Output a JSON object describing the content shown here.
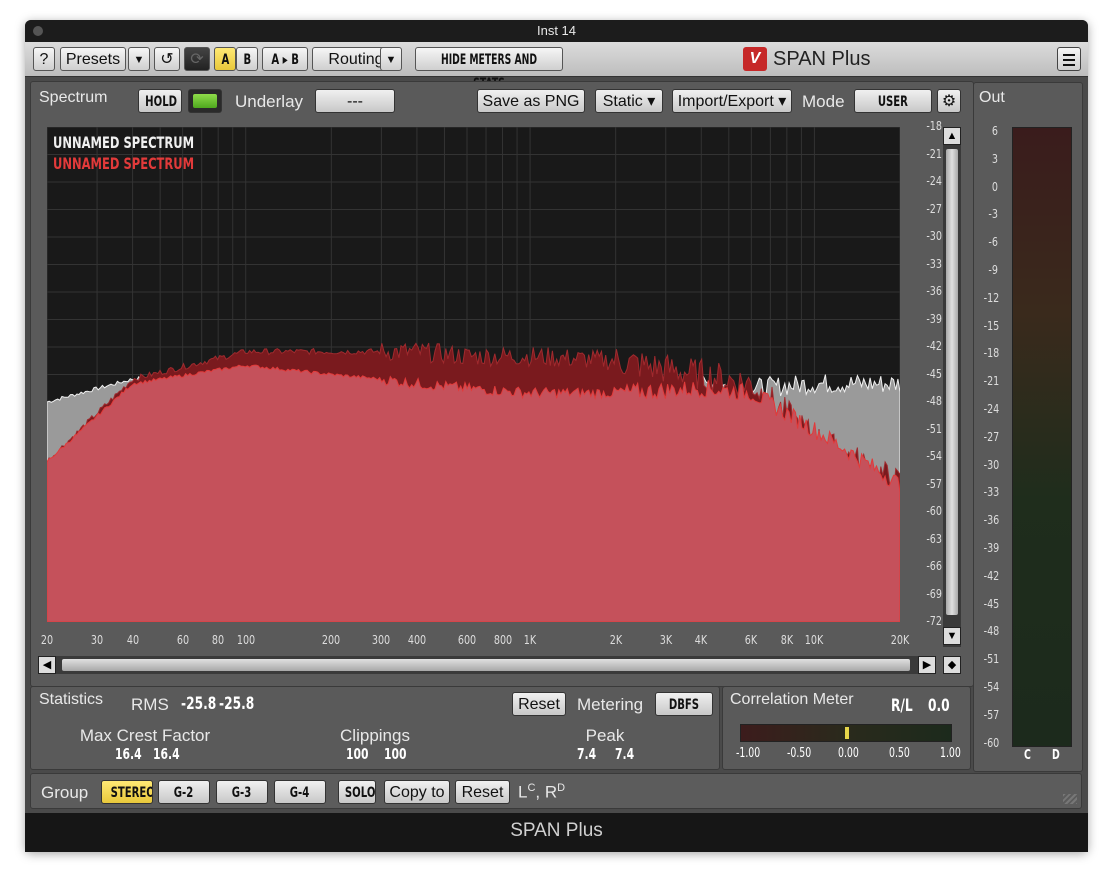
{
  "window": {
    "title": "Inst 14",
    "footer_title": "SPAN Plus"
  },
  "toolbar": {
    "help": "?",
    "presets": "Presets",
    "presets_arrow": "▼",
    "undo": "↺",
    "a": "A",
    "b": "B",
    "a_to_b": "A ▸ B",
    "routing": "Routing",
    "routing_arrow": "▼",
    "hide_meters": "HIDE METERS AND STATS",
    "brand": "SPAN Plus"
  },
  "spectrum": {
    "tab": "Spectrum",
    "hold": "HOLD",
    "underlay_label": "Underlay",
    "underlay_value": "---",
    "save_png": "Save as PNG",
    "static": "Static ▾",
    "import_export": "Import/Export ▾",
    "mode_label": "Mode",
    "mode_value": "USER",
    "legend": [
      {
        "name": "UNNAMED SPECTRUM",
        "color": "#f0f0f0"
      },
      {
        "name": "UNNAMED SPECTRUM",
        "color": "#e23a3a"
      }
    ],
    "y_ticks": [
      "-18",
      "-21",
      "-24",
      "-27",
      "-30",
      "-33",
      "-36",
      "-39",
      "-42",
      "-45",
      "-48",
      "-51",
      "-54",
      "-57",
      "-60",
      "-63",
      "-66",
      "-69",
      "-72"
    ],
    "x_ticks": [
      "20",
      "30",
      "40",
      "60",
      "80",
      "100",
      "200",
      "300",
      "400",
      "600",
      "800",
      "1K",
      "2K",
      "3K",
      "4K",
      "6K",
      "8K",
      "10K",
      "20K"
    ]
  },
  "out": {
    "tab": "Out",
    "ticks": [
      "6",
      "3",
      "0",
      "-3",
      "-6",
      "-9",
      "-12",
      "-15",
      "-18",
      "-21",
      "-24",
      "-27",
      "-30",
      "-33",
      "-36",
      "-39",
      "-42",
      "-45",
      "-48",
      "-51",
      "-54",
      "-57",
      "-60"
    ],
    "channels": [
      "C",
      "D"
    ]
  },
  "statistics": {
    "tab": "Statistics",
    "rms_label": "RMS",
    "rms_l": "-25.8",
    "rms_r": "-25.8",
    "reset": "Reset",
    "metering_label": "Metering",
    "metering_value": "DBFS",
    "crest_label": "Max Crest Factor",
    "crest_l": "16.4",
    "crest_r": "16.4",
    "clip_label": "Clippings",
    "clip_l": "100",
    "clip_r": "100",
    "peak_label": "Peak",
    "peak_l": "7.4",
    "peak_r": "7.4"
  },
  "correlation": {
    "tab": "Correlation Meter",
    "mode": "R/L",
    "value": "0.0",
    "ticks": [
      "-1.00",
      "-0.50",
      "0.00",
      "0.50",
      "1.00"
    ]
  },
  "group": {
    "label": "Group",
    "stereo": "STEREO",
    "g2": "G-2",
    "g3": "G-3",
    "g4": "G-4",
    "solo": "SOLO",
    "copy_to": "Copy to",
    "reset": "Reset",
    "routing_text": "L",
    "routing_sup1": "C",
    "routing_mid": ", R",
    "routing_sup2": "D"
  },
  "chart_data": {
    "type": "area",
    "x": [
      20,
      40,
      100,
      200,
      300,
      400,
      600,
      1000,
      2000,
      4000,
      6000,
      10000,
      20000
    ],
    "xlabel": "",
    "ylabel": "",
    "ylim": [
      -72,
      -18
    ],
    "log_x": true,
    "series": [
      {
        "name": "UNNAMED SPECTRUM",
        "color": "#f0f0f0",
        "values": [
          -48,
          -45.5,
          -44.5,
          -45,
          -45.5,
          -46,
          -46.5,
          -46.5,
          -46.5,
          -46,
          -46.5,
          -46,
          -46
        ]
      },
      {
        "name": "UNNAMED SPECTRUM",
        "color": "#e23a3a",
        "values": [
          -54.5,
          -46,
          -44,
          -45,
          -45.5,
          -46,
          -46.5,
          -47,
          -47,
          -46.5,
          -47,
          -51,
          -57
        ]
      }
    ],
    "series_max_hold": [
      -54.5,
      -45.5,
      -42.5,
      -42.5,
      -42.5,
      -42.5,
      -43,
      -43,
      -43.5,
      -45,
      -46,
      -52,
      -57
    ]
  }
}
